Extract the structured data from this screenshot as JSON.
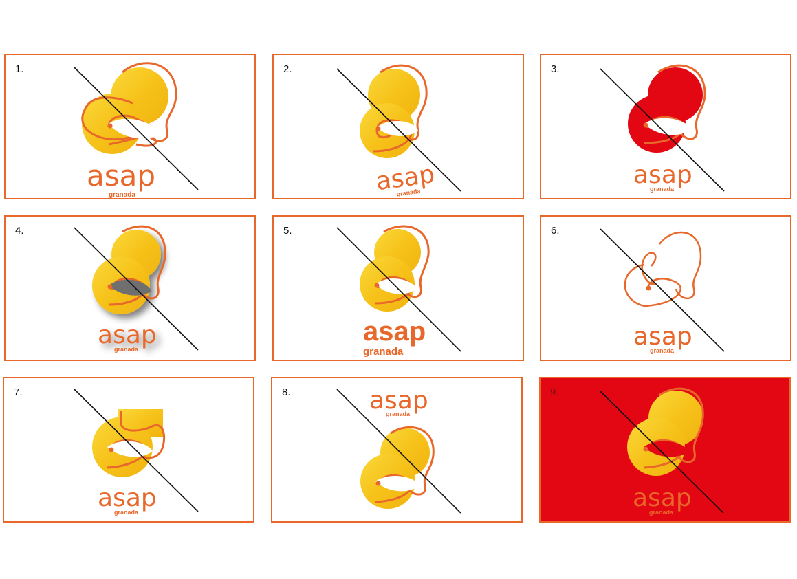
{
  "brand": {
    "word": "asap",
    "sub": "granada"
  },
  "colors": {
    "orange": "#e8672a",
    "yellow": "#f7c21b",
    "red": "#e30613",
    "black": "#111111"
  },
  "panels": [
    {
      "label": "1."
    },
    {
      "label": "2."
    },
    {
      "label": "3."
    },
    {
      "label": "4."
    },
    {
      "label": "5."
    },
    {
      "label": "6."
    },
    {
      "label": "7."
    },
    {
      "label": "8."
    },
    {
      "label": "9."
    }
  ]
}
